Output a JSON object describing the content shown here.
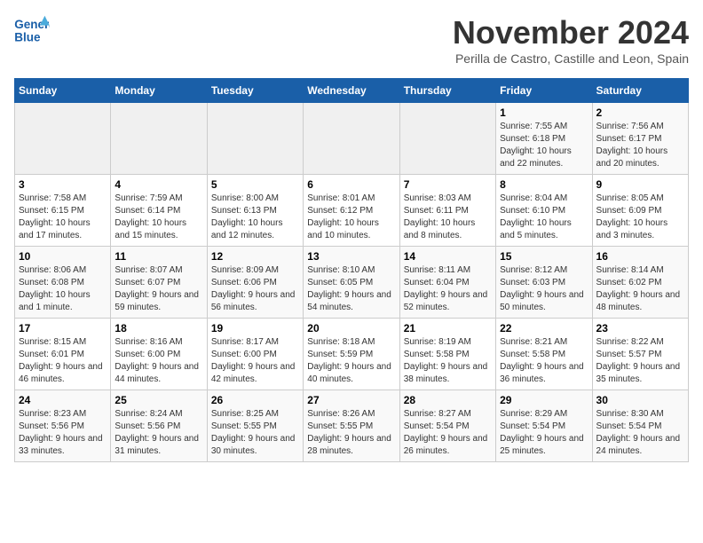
{
  "logo": {
    "text_general": "General",
    "text_blue": "Blue"
  },
  "title": "November 2024",
  "subtitle": "Perilla de Castro, Castille and Leon, Spain",
  "header": {
    "days": [
      "Sunday",
      "Monday",
      "Tuesday",
      "Wednesday",
      "Thursday",
      "Friday",
      "Saturday"
    ]
  },
  "weeks": [
    {
      "cells": [
        {
          "empty": true
        },
        {
          "empty": true
        },
        {
          "empty": true
        },
        {
          "empty": true
        },
        {
          "empty": true
        },
        {
          "day": 1,
          "sunrise": "7:55 AM",
          "sunset": "6:18 PM",
          "daylight": "10 hours and 22 minutes."
        },
        {
          "day": 2,
          "sunrise": "7:56 AM",
          "sunset": "6:17 PM",
          "daylight": "10 hours and 20 minutes."
        }
      ]
    },
    {
      "cells": [
        {
          "day": 3,
          "sunrise": "7:58 AM",
          "sunset": "6:15 PM",
          "daylight": "10 hours and 17 minutes."
        },
        {
          "day": 4,
          "sunrise": "7:59 AM",
          "sunset": "6:14 PM",
          "daylight": "10 hours and 15 minutes."
        },
        {
          "day": 5,
          "sunrise": "8:00 AM",
          "sunset": "6:13 PM",
          "daylight": "10 hours and 12 minutes."
        },
        {
          "day": 6,
          "sunrise": "8:01 AM",
          "sunset": "6:12 PM",
          "daylight": "10 hours and 10 minutes."
        },
        {
          "day": 7,
          "sunrise": "8:03 AM",
          "sunset": "6:11 PM",
          "daylight": "10 hours and 8 minutes."
        },
        {
          "day": 8,
          "sunrise": "8:04 AM",
          "sunset": "6:10 PM",
          "daylight": "10 hours and 5 minutes."
        },
        {
          "day": 9,
          "sunrise": "8:05 AM",
          "sunset": "6:09 PM",
          "daylight": "10 hours and 3 minutes."
        }
      ]
    },
    {
      "cells": [
        {
          "day": 10,
          "sunrise": "8:06 AM",
          "sunset": "6:08 PM",
          "daylight": "10 hours and 1 minute."
        },
        {
          "day": 11,
          "sunrise": "8:07 AM",
          "sunset": "6:07 PM",
          "daylight": "9 hours and 59 minutes."
        },
        {
          "day": 12,
          "sunrise": "8:09 AM",
          "sunset": "6:06 PM",
          "daylight": "9 hours and 56 minutes."
        },
        {
          "day": 13,
          "sunrise": "8:10 AM",
          "sunset": "6:05 PM",
          "daylight": "9 hours and 54 minutes."
        },
        {
          "day": 14,
          "sunrise": "8:11 AM",
          "sunset": "6:04 PM",
          "daylight": "9 hours and 52 minutes."
        },
        {
          "day": 15,
          "sunrise": "8:12 AM",
          "sunset": "6:03 PM",
          "daylight": "9 hours and 50 minutes."
        },
        {
          "day": 16,
          "sunrise": "8:14 AM",
          "sunset": "6:02 PM",
          "daylight": "9 hours and 48 minutes."
        }
      ]
    },
    {
      "cells": [
        {
          "day": 17,
          "sunrise": "8:15 AM",
          "sunset": "6:01 PM",
          "daylight": "9 hours and 46 minutes."
        },
        {
          "day": 18,
          "sunrise": "8:16 AM",
          "sunset": "6:00 PM",
          "daylight": "9 hours and 44 minutes."
        },
        {
          "day": 19,
          "sunrise": "8:17 AM",
          "sunset": "6:00 PM",
          "daylight": "9 hours and 42 minutes."
        },
        {
          "day": 20,
          "sunrise": "8:18 AM",
          "sunset": "5:59 PM",
          "daylight": "9 hours and 40 minutes."
        },
        {
          "day": 21,
          "sunrise": "8:19 AM",
          "sunset": "5:58 PM",
          "daylight": "9 hours and 38 minutes."
        },
        {
          "day": 22,
          "sunrise": "8:21 AM",
          "sunset": "5:58 PM",
          "daylight": "9 hours and 36 minutes."
        },
        {
          "day": 23,
          "sunrise": "8:22 AM",
          "sunset": "5:57 PM",
          "daylight": "9 hours and 35 minutes."
        }
      ]
    },
    {
      "cells": [
        {
          "day": 24,
          "sunrise": "8:23 AM",
          "sunset": "5:56 PM",
          "daylight": "9 hours and 33 minutes."
        },
        {
          "day": 25,
          "sunrise": "8:24 AM",
          "sunset": "5:56 PM",
          "daylight": "9 hours and 31 minutes."
        },
        {
          "day": 26,
          "sunrise": "8:25 AM",
          "sunset": "5:55 PM",
          "daylight": "9 hours and 30 minutes."
        },
        {
          "day": 27,
          "sunrise": "8:26 AM",
          "sunset": "5:55 PM",
          "daylight": "9 hours and 28 minutes."
        },
        {
          "day": 28,
          "sunrise": "8:27 AM",
          "sunset": "5:54 PM",
          "daylight": "9 hours and 26 minutes."
        },
        {
          "day": 29,
          "sunrise": "8:29 AM",
          "sunset": "5:54 PM",
          "daylight": "9 hours and 25 minutes."
        },
        {
          "day": 30,
          "sunrise": "8:30 AM",
          "sunset": "5:54 PM",
          "daylight": "9 hours and 24 minutes."
        }
      ]
    }
  ]
}
